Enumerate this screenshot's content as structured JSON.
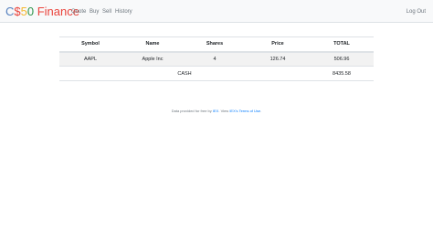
{
  "navbar": {
    "brand": {
      "part1": "C",
      "part2": "$",
      "part3": "5",
      "part4": "0",
      "part5": "Finance"
    },
    "links": {
      "quote": "Quote",
      "buy": "Buy",
      "sell": "Sell",
      "history": "History",
      "logout": "Log Out"
    },
    "colors": {
      "blue": "#537fbe",
      "red": "#ea433b",
      "yellow": "#f5b82e",
      "green": "#2e944b"
    }
  },
  "portfolio": {
    "headers": {
      "symbol": "Symbol",
      "name": "Name",
      "shares": "Shares",
      "price": "Price",
      "total": "TOTAL"
    },
    "rows": [
      {
        "symbol": "AAPL",
        "name": "Apple Inc",
        "shares": "4",
        "price": "126.74",
        "total": "506.96"
      }
    ],
    "cash": {
      "label": "CASH",
      "value": "8435.58"
    }
  },
  "footer": {
    "prefix": "Data provided for free by",
    "iex_link": "IEX",
    "middle": ". View",
    "terms_link": "IEX's Terms of Use",
    "suffix": "."
  }
}
